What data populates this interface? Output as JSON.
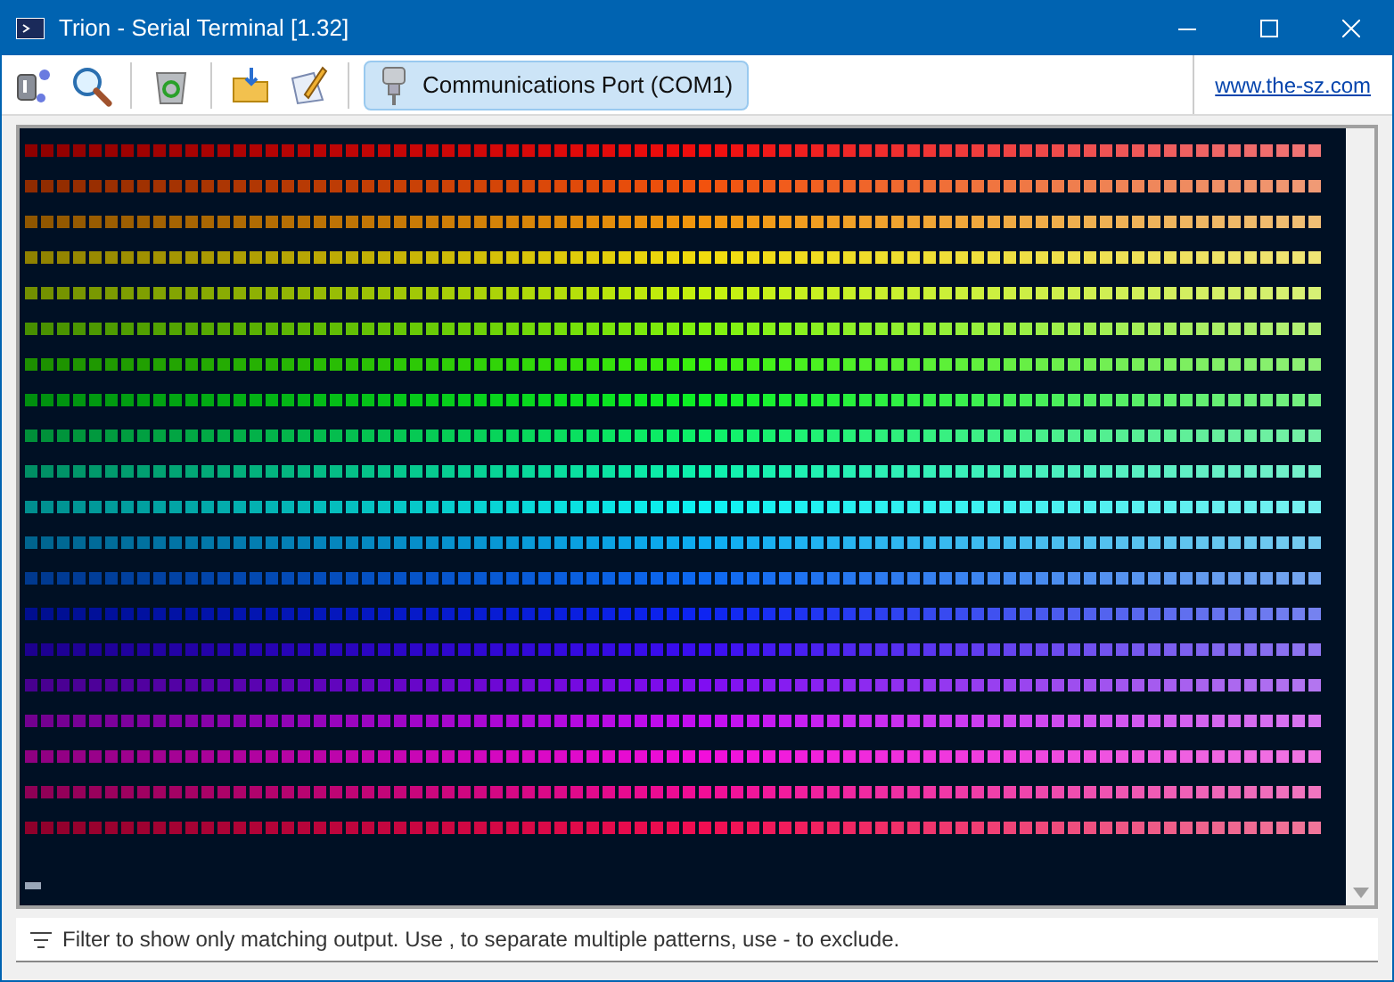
{
  "window": {
    "title": "Trion - Serial Terminal [1.32]"
  },
  "toolbar": {
    "port_button": {
      "label": "Communications Port (COM1)",
      "selected": true
    },
    "link": "www.the-sz.com"
  },
  "filter": {
    "placeholder": "Filter to show only matching output. Use , to separate multiple patterns, use - to exclude."
  }
}
